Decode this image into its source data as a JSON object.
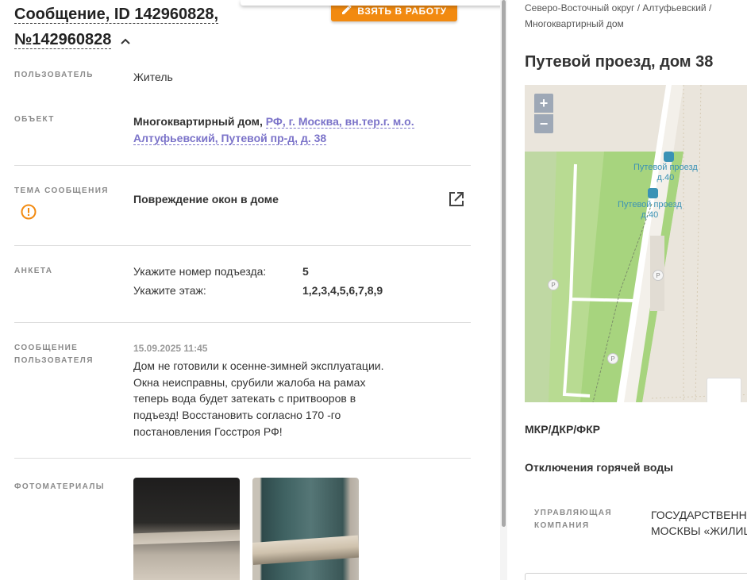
{
  "header": {
    "title_line1": "Сообщение, ID 142960828,",
    "title_line2": "№142960828",
    "take_button": "ВЗЯТЬ В РАБОТУ"
  },
  "fields": {
    "user": {
      "label": "ПОЛЬЗОВАТЕЛЬ",
      "value": "Житель"
    },
    "object": {
      "label": "ОБЪЕКТ",
      "type": "Многоквартирный дом,",
      "address_line1": "РФ, г. Москва, вн.тер.г. м.о.",
      "address_line2": "Алтуфьевский, Путевой пр-д, д. 38"
    },
    "topic": {
      "label_line1": "ТЕМА СООБЩЕНИЯ",
      "value": "Повреждение окон в доме"
    },
    "survey": {
      "label": "АНКЕТА",
      "rows": [
        {
          "q": "Укажите номер подъезда:",
          "a": "5"
        },
        {
          "q": "Укажите этаж:",
          "a": "1,2,3,4,5,6,7,8,9"
        }
      ]
    },
    "message": {
      "label_line1": "СООБЩЕНИЕ",
      "label_line2": "ПОЛЬЗОВАТЕЛЯ",
      "date": "15.09.2025 11:45",
      "text": "Дом не готовили к осенне-зимней эксплуатации. Окна неисправны, срубили жалоба на рамах теперь вода будет затекать с притвооров в подъезд! Восстановить согласно 170 -го постановления Госстроя РФ!"
    },
    "photos": {
      "label": "ФОТОМАТЕРИАЛЫ"
    }
  },
  "right_panel": {
    "breadcrumb": "Северо-Восточный округ / Алтуфьевский / Многоквартирный дом",
    "address_title": "Путевой проезд, дом 38",
    "map": {
      "zoom_in": "+",
      "zoom_out": "−",
      "stop1_line1": "Путевой проезд",
      "stop1_line2": "д.40",
      "stop2_line1": "Путевой проезд",
      "stop2_line2": "д.40",
      "parking": "P"
    },
    "section_mkr": "МКР/ДКР/ФКР",
    "section_hot_water": "Отключения горячей воды",
    "uk_label_line1": "УПРАВЛЯЮЩАЯ",
    "uk_label_line2": "КОМПАНИЯ",
    "uk_value_line1": "ГОСУДАРСТВЕННО",
    "uk_value_line2": "МОСКВЫ «ЖИЛИЩ"
  },
  "colors": {
    "accent_orange": "#f28a10",
    "link_purple": "#7b73c9",
    "warning": "#f28a10"
  }
}
